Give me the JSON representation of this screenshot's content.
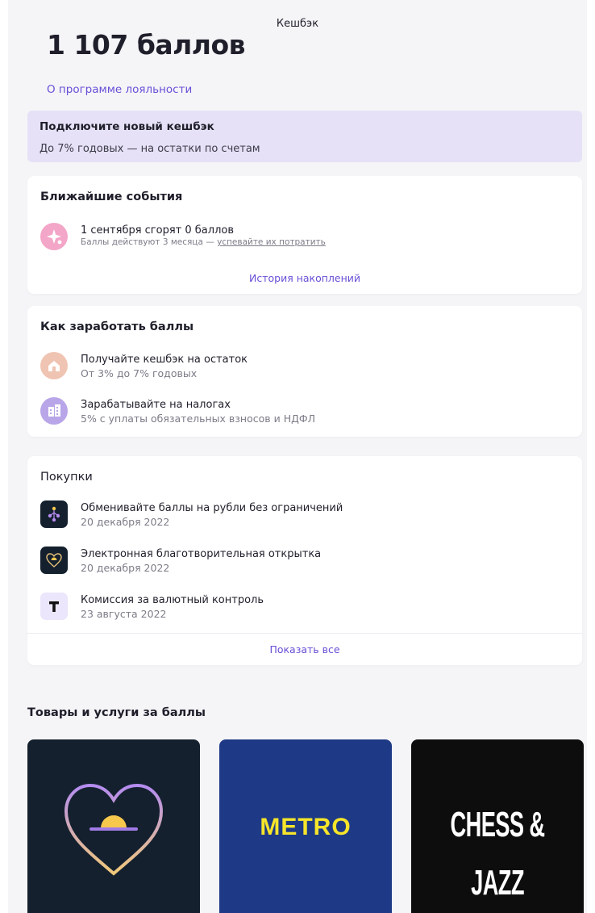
{
  "header": {
    "title": "Кешбэк",
    "balance": "1 107 баллов",
    "loyalty_link": "О программе лояльности"
  },
  "promo": {
    "title": "Подключите новый кешбэк",
    "subtitle": "До 7% годовых — на остатки по счетам"
  },
  "events": {
    "title": "Ближайшие события",
    "item": {
      "title": "1 сентября сгорят 0 баллов",
      "subtitle_prefix": "Баллы действуют 3 месяца — ",
      "subtitle_link": "успевайте их потратить",
      "icon": "sparkle-icon"
    },
    "history_link": "История накоплений"
  },
  "earn": {
    "title": "Как заработать баллы",
    "items": [
      {
        "title": "Получайте кешбэк на остаток",
        "subtitle": "От 3% до 7% годовых",
        "icon": "house-icon"
      },
      {
        "title": "Зарабатывайте на налогах",
        "subtitle": "5% с уплаты обязательных взносов и НДФЛ",
        "icon": "building-icon"
      }
    ]
  },
  "purchases": {
    "title": "Покупки",
    "items": [
      {
        "title": "Обменивайте баллы на рубли без ограничений",
        "date": "20 декабря 2022",
        "icon": "exchange-icon"
      },
      {
        "title": "Электронная благотворительная открытка",
        "date": "20 декабря 2022",
        "icon": "heart-card-icon"
      },
      {
        "title": "Комиссия за валютный контроль",
        "date": "23 августа 2022",
        "icon": "t-logo-icon"
      }
    ],
    "show_all": "Показать все"
  },
  "goods": {
    "title": "Товары и услуги за баллы",
    "tiles": [
      {
        "name": "charity-heart",
        "bg": "#14202e"
      },
      {
        "name": "metro",
        "text": "METRO",
        "bg": "#1e3a86"
      },
      {
        "name": "chess-jazz",
        "text": "CHESS & JAZZ",
        "bg": "#0d0d0d"
      }
    ]
  },
  "colors": {
    "accent": "#6a4fd6",
    "promo_bg": "#e6e1f6",
    "metro_yellow": "#f6e52a"
  }
}
